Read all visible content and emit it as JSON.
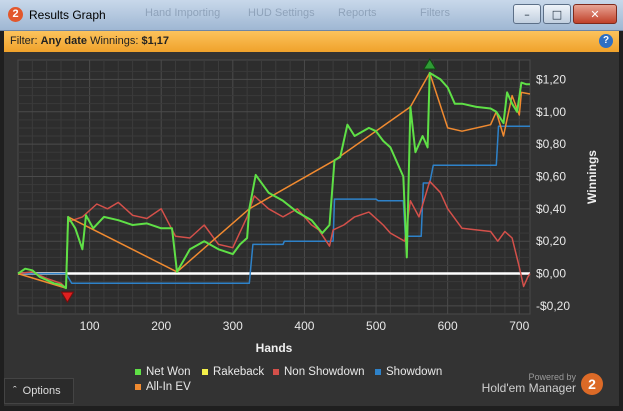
{
  "window": {
    "title": "Results Graph",
    "background_menu": [
      "Hand Importing",
      "HUD Settings",
      "Reports",
      "Filters"
    ]
  },
  "filter": {
    "prefix": "Filter:",
    "date": "Any date",
    "winnings_label": "Winnings:",
    "winnings_value": "$1,17"
  },
  "footer": {
    "options_label": "Options",
    "powered_by": "Powered by",
    "brand": "Hold'em Manager",
    "brand_badge": "2"
  },
  "colors": {
    "net_won": "#5fe046",
    "rakeback": "#f3f04a",
    "non_showdown": "#d4504a",
    "showdown": "#2e82c9",
    "all_in_ev": "#f08a30"
  },
  "chart_data": {
    "type": "line",
    "xlabel": "Hands",
    "ylabel": "Winnings",
    "xlim": [
      0,
      715
    ],
    "ylim": [
      -0.25,
      1.32
    ],
    "x_ticks": [
      100,
      200,
      300,
      400,
      500,
      600,
      700
    ],
    "x_tick_labels": [
      "100",
      "200",
      "300",
      "400",
      "500",
      "600",
      "700"
    ],
    "y_ticks": [
      -0.2,
      0,
      0.2,
      0.4,
      0.6,
      0.8,
      1.0,
      1.2
    ],
    "y_tick_labels": [
      "-$0,20",
      "$0,00",
      "$0,20",
      "$0,40",
      "$0,60",
      "$0,80",
      "$1,00",
      "$1,20"
    ],
    "grid": true,
    "legend_position": "bottom",
    "min_marker": {
      "x": 69,
      "y": -0.09
    },
    "max_marker": {
      "x": 575,
      "y": 1.24
    },
    "series": [
      {
        "name": "Net Won",
        "color": "#5fe046",
        "points": [
          [
            0,
            0
          ],
          [
            10,
            0.03
          ],
          [
            20,
            0.02
          ],
          [
            30,
            -0.02
          ],
          [
            40,
            -0.04
          ],
          [
            50,
            -0.06
          ],
          [
            60,
            -0.07
          ],
          [
            67,
            -0.09
          ],
          [
            70,
            0.35
          ],
          [
            80,
            0.28
          ],
          [
            90,
            0.15
          ],
          [
            95,
            0.36
          ],
          [
            105,
            0.28
          ],
          [
            120,
            0.35
          ],
          [
            140,
            0.33
          ],
          [
            160,
            0.3
          ],
          [
            180,
            0.31
          ],
          [
            200,
            0.28
          ],
          [
            215,
            0.28
          ],
          [
            222,
            0.01
          ],
          [
            240,
            0.15
          ],
          [
            260,
            0.2
          ],
          [
            280,
            0.15
          ],
          [
            300,
            0.12
          ],
          [
            310,
            0.18
          ],
          [
            320,
            0.22
          ],
          [
            323,
            0.4
          ],
          [
            332,
            0.61
          ],
          [
            350,
            0.5
          ],
          [
            370,
            0.45
          ],
          [
            390,
            0.38
          ],
          [
            410,
            0.33
          ],
          [
            425,
            0.25
          ],
          [
            435,
            0.3
          ],
          [
            442,
            0.7
          ],
          [
            450,
            0.72
          ],
          [
            460,
            0.92
          ],
          [
            470,
            0.85
          ],
          [
            490,
            0.9
          ],
          [
            500,
            0.88
          ],
          [
            510,
            0.82
          ],
          [
            520,
            0.78
          ],
          [
            538,
            0.6
          ],
          [
            543,
            0.1
          ],
          [
            548,
            1.03
          ],
          [
            555,
            0.75
          ],
          [
            565,
            0.85
          ],
          [
            572,
            0.78
          ],
          [
            575,
            1.24
          ],
          [
            590,
            1.2
          ],
          [
            600,
            1.15
          ],
          [
            610,
            1.05
          ],
          [
            620,
            1.05
          ],
          [
            640,
            1.03
          ],
          [
            660,
            1.02
          ],
          [
            668,
            1.0
          ],
          [
            678,
            0.93
          ],
          [
            683,
            1.12
          ],
          [
            690,
            1.05
          ],
          [
            697,
            1.0
          ],
          [
            703,
            1.18
          ],
          [
            710,
            1.17
          ],
          [
            715,
            1.17
          ]
        ]
      },
      {
        "name": "Rakeback",
        "color": "#f3f04a",
        "points": [
          [
            0,
            0
          ],
          [
            715,
            0
          ]
        ]
      },
      {
        "name": "Non Showdown",
        "color": "#d4504a",
        "points": [
          [
            0,
            0
          ],
          [
            20,
            0.01
          ],
          [
            40,
            -0.03
          ],
          [
            60,
            -0.06
          ],
          [
            67,
            -0.09
          ],
          [
            70,
            0.32
          ],
          [
            90,
            0.35
          ],
          [
            110,
            0.43
          ],
          [
            125,
            0.4
          ],
          [
            140,
            0.44
          ],
          [
            160,
            0.36
          ],
          [
            180,
            0.34
          ],
          [
            200,
            0.4
          ],
          [
            220,
            0.23
          ],
          [
            240,
            0.22
          ],
          [
            260,
            0.3
          ],
          [
            280,
            0.18
          ],
          [
            300,
            0.16
          ],
          [
            320,
            0.35
          ],
          [
            330,
            0.48
          ],
          [
            350,
            0.4
          ],
          [
            370,
            0.35
          ],
          [
            390,
            0.4
          ],
          [
            410,
            0.3
          ],
          [
            420,
            0.27
          ],
          [
            435,
            0.17
          ],
          [
            440,
            0.27
          ],
          [
            455,
            0.3
          ],
          [
            470,
            0.35
          ],
          [
            490,
            0.38
          ],
          [
            510,
            0.3
          ],
          [
            520,
            0.25
          ],
          [
            540,
            0.2
          ],
          [
            548,
            0.45
          ],
          [
            560,
            0.35
          ],
          [
            575,
            0.57
          ],
          [
            590,
            0.5
          ],
          [
            600,
            0.4
          ],
          [
            620,
            0.28
          ],
          [
            640,
            0.27
          ],
          [
            660,
            0.26
          ],
          [
            670,
            0.2
          ],
          [
            680,
            0.26
          ],
          [
            690,
            0.22
          ],
          [
            700,
            0.04
          ],
          [
            706,
            -0.08
          ],
          [
            712,
            -0.02
          ],
          [
            715,
            0.0
          ]
        ]
      },
      {
        "name": "Showdown",
        "color": "#2e82c9",
        "points": [
          [
            0,
            0
          ],
          [
            67,
            0
          ],
          [
            75,
            -0.06
          ],
          [
            323,
            -0.06
          ],
          [
            328,
            0.18
          ],
          [
            370,
            0.18
          ],
          [
            372,
            0.2
          ],
          [
            440,
            0.2
          ],
          [
            442,
            0.46
          ],
          [
            500,
            0.46
          ],
          [
            503,
            0.45
          ],
          [
            538,
            0.45
          ],
          [
            541,
            0.23
          ],
          [
            563,
            0.23
          ],
          [
            566,
            0.56
          ],
          [
            575,
            0.56
          ],
          [
            580,
            0.67
          ],
          [
            668,
            0.67
          ],
          [
            671,
            0.91
          ],
          [
            715,
            0.91
          ]
        ]
      },
      {
        "name": "All-In EV",
        "color": "#f08a30",
        "points": [
          [
            0,
            0
          ],
          [
            67,
            -0.09
          ],
          [
            70,
            0.35
          ],
          [
            222,
            0.01
          ],
          [
            323,
            0.4
          ],
          [
            442,
            0.7
          ],
          [
            548,
            1.03
          ],
          [
            575,
            1.24
          ],
          [
            600,
            0.9
          ],
          [
            620,
            0.88
          ],
          [
            660,
            0.92
          ],
          [
            668,
            1.0
          ],
          [
            678,
            0.85
          ],
          [
            690,
            1.1
          ],
          [
            700,
            0.98
          ],
          [
            703,
            1.12
          ],
          [
            715,
            1.11
          ]
        ]
      }
    ]
  }
}
